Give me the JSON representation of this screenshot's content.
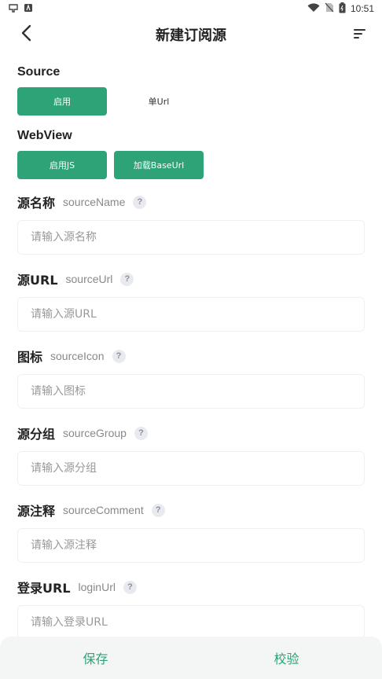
{
  "status_bar": {
    "time": "10:51",
    "left_icons": [
      "notification-icon",
      "app-icon"
    ],
    "right_icons": [
      "wifi-icon",
      "no-sim-icon",
      "battery-icon"
    ]
  },
  "app_bar": {
    "title": "新建订阅源",
    "back_icon": "chevron-left-icon",
    "menu_icon": "sort-lines-icon"
  },
  "source_section": {
    "title": "Source",
    "buttons": [
      {
        "label": "启用",
        "active": true
      },
      {
        "label": "单Url",
        "active": false
      }
    ]
  },
  "webview_section": {
    "title": "WebView",
    "buttons": [
      {
        "label": "启用JS",
        "active": true
      },
      {
        "label": "加载BaseUrl",
        "active": true
      }
    ]
  },
  "fields": [
    {
      "label": "源名称",
      "key": "sourceName",
      "placeholder": "请输入源名称",
      "value": ""
    },
    {
      "label": "源URL",
      "key": "sourceUrl",
      "placeholder": "请输入源URL",
      "value": ""
    },
    {
      "label": "图标",
      "key": "sourceIcon",
      "placeholder": "请输入图标",
      "value": ""
    },
    {
      "label": "源分组",
      "key": "sourceGroup",
      "placeholder": "请输入源分组",
      "value": ""
    },
    {
      "label": "源注释",
      "key": "sourceComment",
      "placeholder": "请输入源注释",
      "value": ""
    },
    {
      "label": "登录URL",
      "key": "loginUrl",
      "placeholder": "请输入登录URL",
      "value": ""
    }
  ],
  "help_symbol": "?",
  "bottom_bar": {
    "save_label": "保存",
    "verify_label": "校验"
  },
  "colors": {
    "accent": "#2da377",
    "help_bg": "#e8eaf0",
    "bottom_bar_bg": "#f4f6f5"
  }
}
